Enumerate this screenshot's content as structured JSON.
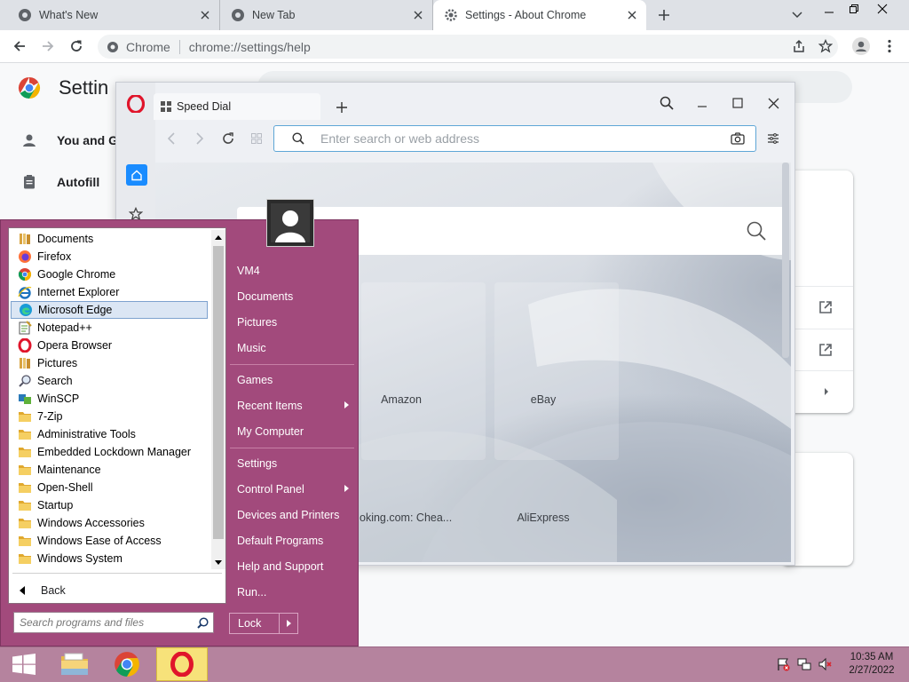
{
  "chrome": {
    "tabs": [
      {
        "label": "What's New"
      },
      {
        "label": "New Tab"
      },
      {
        "label": "Settings - About Chrome"
      }
    ],
    "omnibox": {
      "scheme": "Chrome",
      "url": "chrome://settings/help"
    },
    "settings": {
      "title": "Settin",
      "nav": [
        {
          "label": "You and G"
        },
        {
          "label": "Autofill"
        }
      ]
    }
  },
  "opera": {
    "tab_label": "Speed Dial",
    "address_placeholder": "Enter search or web address",
    "speed_dial": [
      {
        "label": "Amazon"
      },
      {
        "label": "eBay"
      },
      {
        "label": "oking.com: Chea..."
      },
      {
        "label": "AliExpress"
      }
    ]
  },
  "start_menu": {
    "programs": [
      {
        "label": "Documents",
        "icon": "library-icon"
      },
      {
        "label": "Firefox",
        "icon": "firefox-icon"
      },
      {
        "label": "Google Chrome",
        "icon": "chrome-icon"
      },
      {
        "label": "Internet Explorer",
        "icon": "ie-icon"
      },
      {
        "label": "Microsoft Edge",
        "icon": "edge-icon",
        "highlighted": true
      },
      {
        "label": "Notepad++",
        "icon": "notepad-icon"
      },
      {
        "label": "Opera Browser",
        "icon": "opera-icon"
      },
      {
        "label": "Pictures",
        "icon": "library-icon"
      },
      {
        "label": "Search",
        "icon": "search-icon"
      },
      {
        "label": "WinSCP",
        "icon": "winscp-icon"
      },
      {
        "label": "7-Zip",
        "icon": "folder-icon"
      },
      {
        "label": "Administrative Tools",
        "icon": "folder-icon"
      },
      {
        "label": "Embedded Lockdown Manager",
        "icon": "folder-icon"
      },
      {
        "label": "Maintenance",
        "icon": "folder-icon"
      },
      {
        "label": "Open-Shell",
        "icon": "folder-icon"
      },
      {
        "label": "Startup",
        "icon": "folder-icon"
      },
      {
        "label": "Windows Accessories",
        "icon": "folder-icon"
      },
      {
        "label": "Windows Ease of Access",
        "icon": "folder-icon"
      },
      {
        "label": "Windows System",
        "icon": "folder-icon"
      }
    ],
    "back_label": "Back",
    "search_placeholder": "Search programs and files",
    "right_items": [
      {
        "label": "VM4"
      },
      {
        "label": "Documents"
      },
      {
        "label": "Pictures"
      },
      {
        "label": "Music"
      },
      {
        "label": "Games"
      },
      {
        "label": "Recent Items",
        "submenu": true
      },
      {
        "label": "My Computer"
      },
      {
        "label": "Settings"
      },
      {
        "label": "Control Panel",
        "submenu": true
      },
      {
        "label": "Devices and Printers"
      },
      {
        "label": "Default Programs"
      },
      {
        "label": "Help and Support"
      },
      {
        "label": "Run..."
      }
    ],
    "lock_label": "Lock"
  },
  "taskbar": {
    "time": "10:35 AM",
    "date": "2/27/2022"
  },
  "colors": {
    "start_menu_bg": "#a24a7c",
    "taskbar_bg": "#b5839e",
    "chrome_tabstrip": "#dee1e6",
    "opera_red": "#e0152b"
  }
}
